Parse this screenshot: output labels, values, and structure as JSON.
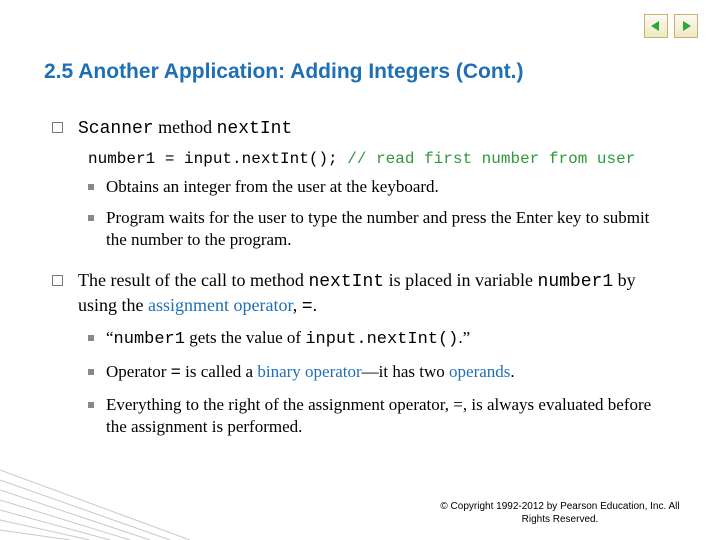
{
  "heading": "2.5  Another Application: Adding Integers (Cont.)",
  "bullets": {
    "b1_pre": "Scanner",
    "b1_mid": " method ",
    "b1_code": "nextInt",
    "code_line_a": "number1 = input.nextInt(); ",
    "code_line_b": "// read first number from user",
    "b1_sub1": "Obtains an integer from the user at the keyboard.",
    "b1_sub2": "Program waits for the user to type the number and press the Enter key to submit the number to the program.",
    "b2_a": "The result of the call to method ",
    "b2_b": "nextInt",
    "b2_c": " is placed in variable ",
    "b2_d": "number1",
    "b2_e": " by using the ",
    "b2_f": "assignment operator",
    "b2_g": ", ",
    "b2_h": "=",
    "b2_i": ".",
    "b2_sub1_a": "“",
    "b2_sub1_b": "number1",
    "b2_sub1_c": " gets the value of ",
    "b2_sub1_d": "input.nextInt()",
    "b2_sub1_e": ".”",
    "b2_sub2_a": "Operator ",
    "b2_sub2_b": "=",
    "b2_sub2_c": " is called a ",
    "b2_sub2_d": "binary operator",
    "b2_sub2_e": "—it has two ",
    "b2_sub2_f": "operands",
    "b2_sub2_g": ".",
    "b2_sub3": "Everything to the right of the assignment operator, =, is always evaluated before the assignment is performed."
  },
  "copyright": "© Copyright 1992-2012 by Pearson Education, Inc. All Rights Reserved."
}
